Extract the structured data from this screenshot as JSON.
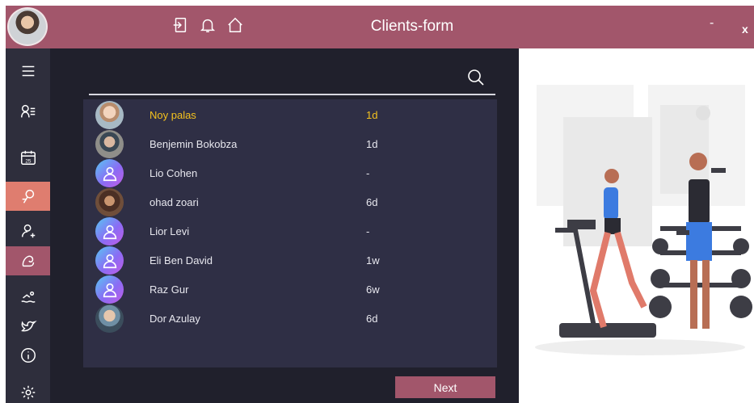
{
  "header": {
    "title": "Clients-form",
    "minimize_label": "-",
    "close_label": "x"
  },
  "search": {
    "placeholder": ""
  },
  "clients": [
    {
      "name": "Noy palas",
      "last_seen": "1d",
      "avatar": "photo",
      "highlighted": true
    },
    {
      "name": "Benjemin Bokobza",
      "last_seen": "1d",
      "avatar": "photo",
      "highlighted": false
    },
    {
      "name": "Lio Cohen",
      "last_seen": "-",
      "avatar": "default",
      "highlighted": false
    },
    {
      "name": "ohad zoari",
      "last_seen": "6d",
      "avatar": "photo",
      "highlighted": false
    },
    {
      "name": "Lior Levi",
      "last_seen": "-",
      "avatar": "default",
      "highlighted": false
    },
    {
      "name": "Eli Ben David",
      "last_seen": "1w",
      "avatar": "default",
      "highlighted": false
    },
    {
      "name": "Raz Gur",
      "last_seen": "6w",
      "avatar": "default",
      "highlighted": false
    },
    {
      "name": "Dor Azulay",
      "last_seen": "6d",
      "avatar": "photo",
      "highlighted": false
    }
  ],
  "footer": {
    "next_label": "Next"
  },
  "colors": {
    "accent": "#a2566b",
    "accent_alt": "#df7d6f",
    "sidebar_bg": "#2e2e3c",
    "panel_bg": "#2f2f45",
    "highlight_text": "#f4c21e"
  },
  "sidebar_icons": [
    "menu-icon",
    "client-list-icon",
    "calendar-icon",
    "fitness-icon",
    "add-user-icon",
    "muscle-icon",
    "swimming-icon",
    "bird-icon",
    "info-icon",
    "settings-icon"
  ]
}
